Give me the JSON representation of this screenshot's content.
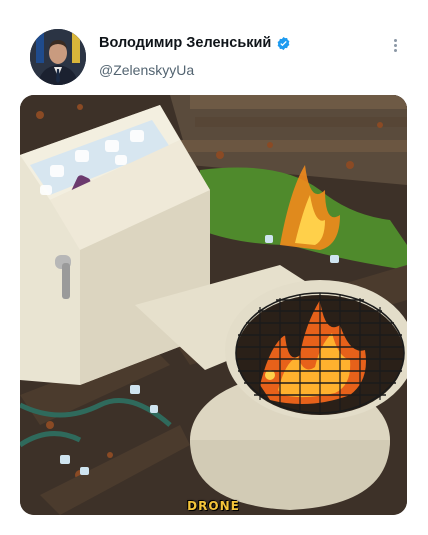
{
  "tweet": {
    "author_name": "Володимир Зеленський",
    "author_handle": "@ZelenskyyUa",
    "verified_icon": "verified-badge-icon",
    "menu_icon": "more-options-icon",
    "media": {
      "description_icon": "toilet-grill-photo",
      "watermark_text": "DRONE"
    }
  },
  "colors": {
    "verified": "#1d9bf0",
    "name": "#0f1419",
    "handle": "#536471",
    "watermark": "#f4c43a"
  }
}
